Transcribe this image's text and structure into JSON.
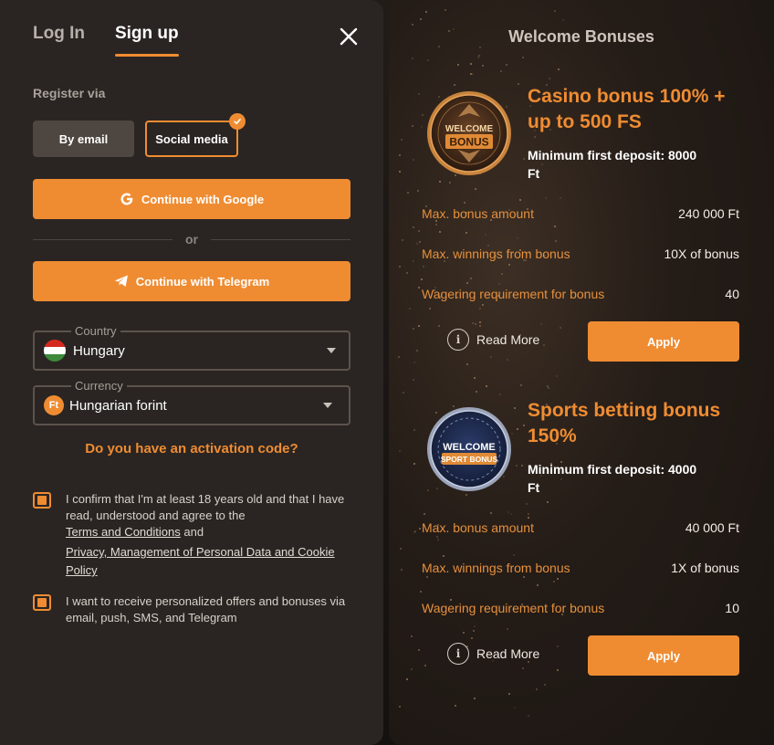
{
  "auth": {
    "tabs": [
      {
        "label": "Log In"
      },
      {
        "label": "Sign up"
      }
    ],
    "register_via": "Register via",
    "methods": {
      "email": "By email",
      "social": "Social media"
    },
    "google_button": "Continue with Google",
    "or_text": "or",
    "telegram_button": "Continue with Telegram",
    "country": {
      "label": "Country",
      "value": "Hungary"
    },
    "currency": {
      "label": "Currency",
      "value": "Hungarian forint",
      "symbol": "Ft"
    },
    "activation_code": "Do you have an activation code?",
    "consent_age": {
      "text": "I confirm that I'm at least 18 years old and that I have read, understood and agree to the",
      "terms_link": "Terms and Conditions",
      "and": "and",
      "privacy_link": "Privacy, Management of Personal Data and Cookie Policy"
    },
    "consent_offers": "I want to receive personalized offers and bonuses via email, push, SMS, and Telegram"
  },
  "bonuses": {
    "title": "Welcome Bonuses",
    "items": [
      {
        "medal_line1": "WELCOME",
        "medal_line2": "BONUS",
        "title": "Casino bonus 100% + up to 500 FS",
        "min_deposit": "Minimum first deposit: 8000 Ft",
        "max_bonus_label": "Max. bonus amount",
        "max_bonus_value": "240 000 Ft",
        "max_win_label": "Max. winnings from bonus",
        "max_win_value": "10X of bonus",
        "wagering_label": "Wagering requirement for bonus",
        "wagering_value": "40",
        "read_more": "Read More",
        "apply": "Apply"
      },
      {
        "medal_line1": "WELCOME",
        "medal_line2": "SPORT BONUS",
        "title": "Sports betting bonus 150%",
        "min_deposit": "Minimum first deposit: 4000 Ft",
        "max_bonus_label": "Max. bonus amount",
        "max_bonus_value": "40 000 Ft",
        "max_win_label": "Max. winnings from bonus",
        "max_win_value": "1X of bonus",
        "wagering_label": "Wagering requirement for bonus",
        "wagering_value": "10",
        "read_more": "Read More",
        "apply": "Apply"
      }
    ]
  },
  "colors": {
    "accent": "#ef8c32",
    "panel": "#2a2522",
    "flag_red": "#d52b1e",
    "flag_white": "#ffffff",
    "flag_green": "#3c8a3a"
  },
  "icons": [
    "close-icon",
    "google-icon",
    "telegram-icon",
    "check-icon",
    "hungary-flag-icon",
    "forint-icon",
    "chevron-down-icon",
    "info-icon",
    "casino-medal-icon",
    "sport-medal-icon"
  ]
}
